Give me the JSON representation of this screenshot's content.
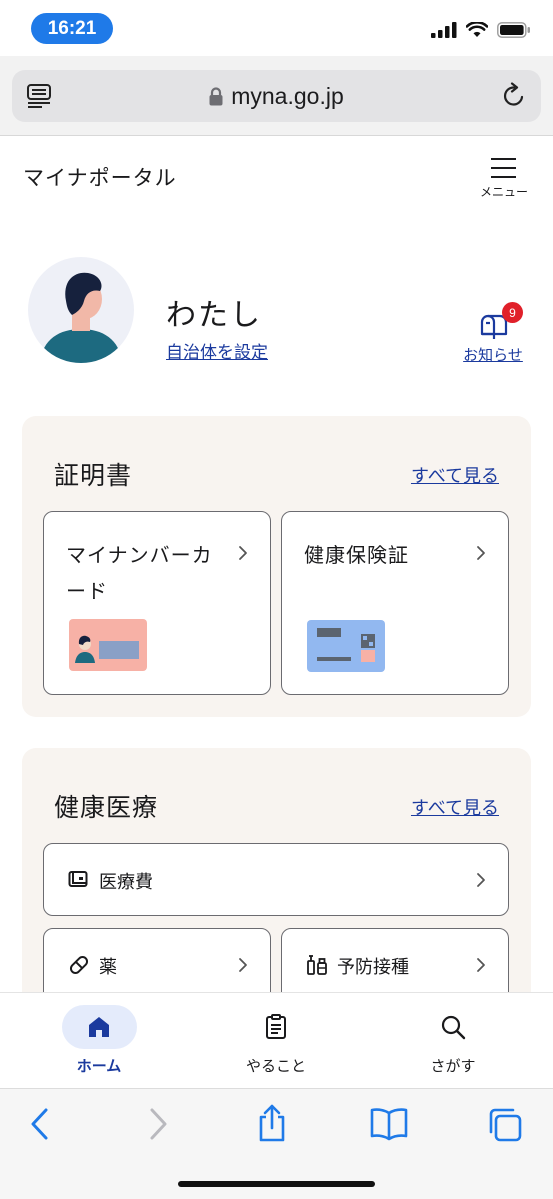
{
  "status_bar": {
    "time": "16:21",
    "icons": [
      "signal-icon",
      "wifi-icon",
      "battery-icon"
    ]
  },
  "browser": {
    "url": "myna.go.jp",
    "icons": [
      "reader-icon",
      "lock-icon",
      "reload-icon"
    ]
  },
  "header": {
    "title": "マイナポータル",
    "menu_label": "メニュー"
  },
  "profile": {
    "name": "わたし",
    "link": "自治体を設定",
    "notice_label": "お知らせ",
    "notice_count": "9"
  },
  "certificates": {
    "title": "証明書",
    "see_all": "すべて見る",
    "cards": [
      {
        "label": "マイナンバーカード"
      },
      {
        "label": "健康保険証"
      }
    ]
  },
  "health": {
    "title": "健康医療",
    "see_all": "すべて見る",
    "items": [
      {
        "label": "医療費",
        "icon": "wallet-icon"
      },
      {
        "label": "薬",
        "icon": "pill-icon"
      },
      {
        "label": "予防接種",
        "icon": "vaccine-icon"
      }
    ]
  },
  "app_nav": [
    {
      "label": "ホーム",
      "icon": "home-icon",
      "active": true
    },
    {
      "label": "やること",
      "icon": "clipboard-icon",
      "active": false
    },
    {
      "label": "さがす",
      "icon": "search-icon",
      "active": false
    }
  ],
  "safari_toolbar": [
    "back-icon",
    "forward-icon",
    "share-icon",
    "bookmarks-icon",
    "tabs-icon"
  ],
  "colors": {
    "accent": "#1b3a9e",
    "section_bg": "#f8f4f0",
    "badge": "#e0202a",
    "time_pill": "#1f7ae8"
  }
}
